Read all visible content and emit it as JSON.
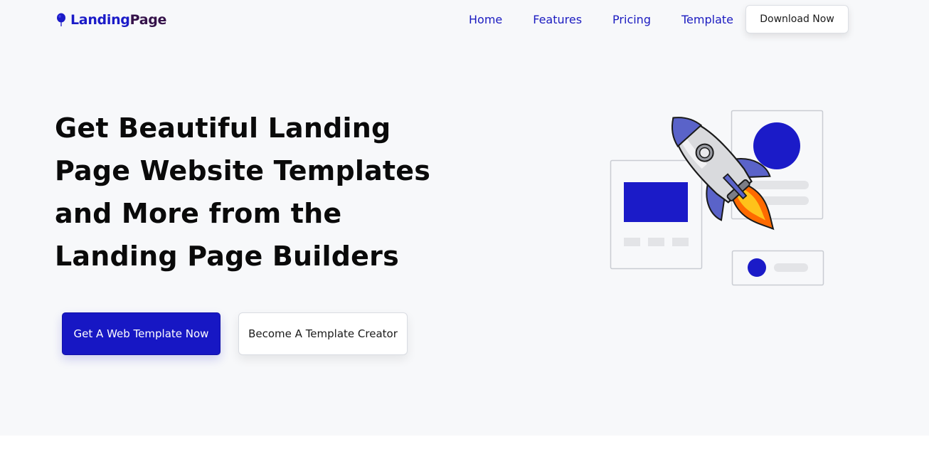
{
  "brand": {
    "icon": "balloon-pin-icon",
    "name_part1": "Landing",
    "name_part2": "Page",
    "color_primary": "#1b1bc8",
    "color_secondary": "#35124a"
  },
  "nav": {
    "items": [
      {
        "label": "Home"
      },
      {
        "label": "Features"
      },
      {
        "label": "Pricing"
      },
      {
        "label": "Template"
      }
    ],
    "cta_label": "Download Now"
  },
  "hero": {
    "headline_lines": [
      "Get Beautiful Landing",
      "Page Website Templates",
      "and More from the",
      "Landing Page Builders"
    ],
    "primary_cta": "Get A Web Template Now",
    "secondary_cta": "Become A Template Creator",
    "illustration": "rocket-launch-illustration"
  },
  "colors": {
    "accent": "#1717c4",
    "hero_background": "#f7f8fa",
    "text": "#0a0a0a"
  }
}
